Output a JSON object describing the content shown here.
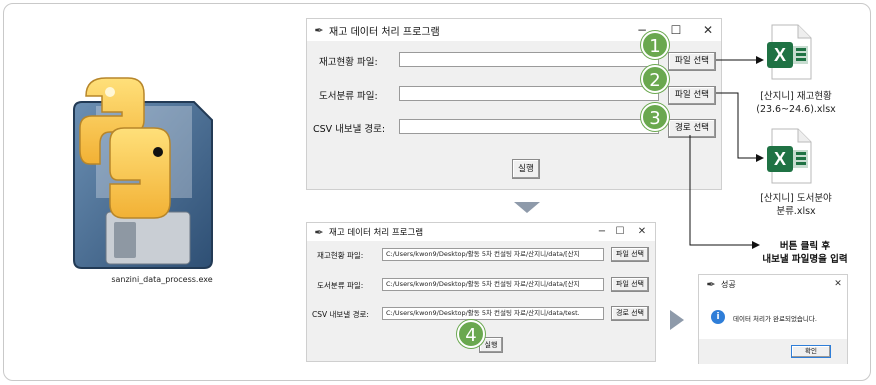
{
  "exe": {
    "filename": "sanzini_data_process.exe"
  },
  "window1": {
    "title": "재고 데이터 처리 프로그램",
    "minimize": "−",
    "maximize": "☐",
    "close": "✕",
    "rows": [
      {
        "label": "재고현황 파일:",
        "value": "",
        "button": "파일 선택",
        "badge": "1"
      },
      {
        "label": "도서분류 파일:",
        "value": "",
        "button": "파일 선택",
        "badge": "2"
      },
      {
        "label": "CSV 내보낼 경로:",
        "value": "",
        "button": "경로 선택",
        "badge": "3"
      }
    ],
    "run_button": "실행"
  },
  "window2": {
    "title": "재고 데이터 처리 프로그램",
    "minimize": "−",
    "maximize": "☐",
    "close": "✕",
    "rows": [
      {
        "label": "재고현황 파일:",
        "value": "C:/Users/kwon9/Desktop/활동 5차 컨설팅 자료/산지니/data/[산지",
        "button": "파일 선택"
      },
      {
        "label": "도서분류 파일:",
        "value": "C:/Users/kwon9/Desktop/활동 5차 컨설팅 자료/산지니/data/[산지",
        "button": "파일 선택"
      },
      {
        "label": "CSV 내보낼 경로:",
        "value": "C:/Users/kwon9/Desktop/활동 5차 컨설팅 자료/산지니/data/test.",
        "button": "경로 선택"
      }
    ],
    "run_button": "실행",
    "badge": "4"
  },
  "files": [
    {
      "name_line1": "[산지니] 재고현황",
      "name_line2": "(23.6~24.6).xlsx"
    },
    {
      "name_line1": "[산지니] 도서분야",
      "name_line2": "분류.xlsx"
    }
  ],
  "note": {
    "line1": "버튼 클릭 후",
    "line2": "내보낼 파일명을 입력"
  },
  "dialog": {
    "title": "성공",
    "close": "✕",
    "message": "데이터 처리가 완료되었습니다.",
    "ok_button": "확인"
  },
  "colors": {
    "badge": "#6aa84f",
    "excel": "#1f7244",
    "arrow_gray": "#8e9aaa"
  }
}
